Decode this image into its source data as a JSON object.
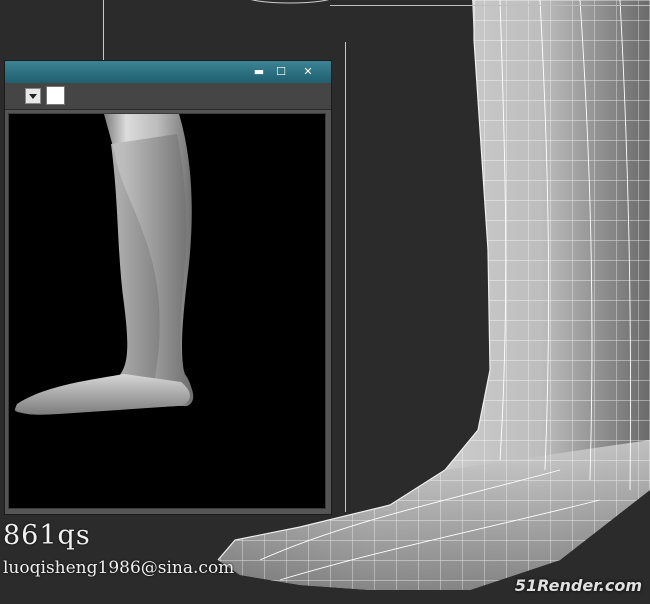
{
  "render_window": {
    "controls": [
      {
        "name": "minimize",
        "glyph": "▬"
      },
      {
        "name": "maximize",
        "glyph": "☐"
      },
      {
        "name": "close",
        "glyph": "✕"
      }
    ]
  },
  "overlay": {
    "handle": "861qs",
    "email": "luoqisheng1986@sina.com"
  },
  "watermark": {
    "brand": "51Render.com"
  },
  "colors": {
    "viewport_bg": "#2b2b2b",
    "titlebar": "#2a7080",
    "canvas_bg": "#000000",
    "wireframe": "#ffffff",
    "watermark_accent": "#e0252b"
  },
  "icons": [
    "minimize-icon",
    "maximize-icon",
    "close-icon",
    "dropdown-arrow-icon"
  ]
}
